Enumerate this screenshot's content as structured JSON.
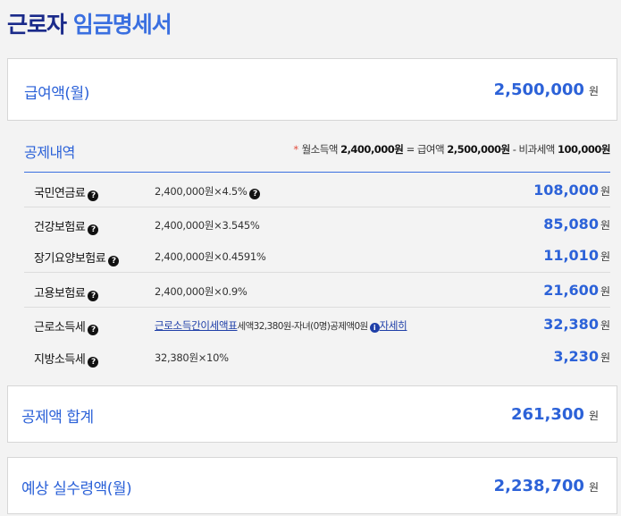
{
  "title": {
    "part1": "근로자",
    "part2": "임금명세서"
  },
  "salary": {
    "label": "급여액(월)",
    "value": "2,500,000",
    "unit": "원"
  },
  "deductions": {
    "header": "공제내역",
    "formula": {
      "asterisk": "*",
      "text1": "월소득액",
      "value1": "2,400,000원",
      "text2": "= 급여액",
      "value2": "2,500,000원",
      "text3": "- 비과세액",
      "value3": "100,000원"
    },
    "items": [
      {
        "name": "국민연금료",
        "calc": "2,400,000원×4.5%",
        "amount": "108,000",
        "unit": "원"
      },
      {
        "name": "건강보험료",
        "calc": "2,400,000원×3.545%",
        "amount": "85,080",
        "unit": "원"
      },
      {
        "name": "장기요양보험료",
        "calc": "2,400,000원×0.4591%",
        "amount": "11,010",
        "unit": "원"
      },
      {
        "name": "고용보험료",
        "calc": "2,400,000원×0.9%",
        "amount": "21,600",
        "unit": "원"
      },
      {
        "name": "근로소득세",
        "calc_link": "근로소득간이세액표",
        "calc_rest": "세액32,380원-자녀(0명)공제액0원",
        "detail": "자세히",
        "amount": "32,380",
        "unit": "원"
      },
      {
        "name": "지방소득세",
        "calc": "32,380원×10%",
        "amount": "3,230",
        "unit": "원"
      }
    ]
  },
  "total_deduction": {
    "label": "공제액 합계",
    "value": "261,300",
    "unit": "원"
  },
  "net_pay": {
    "label": "예상 실수령액(월)",
    "value": "2,238,700",
    "unit": "원"
  },
  "icons": {
    "help": "question-circle-icon",
    "info": "info-circle-icon"
  },
  "colors": {
    "accent": "#2c62d8",
    "title_dark": "#1a2a8a",
    "asterisk": "#e24a3b"
  }
}
